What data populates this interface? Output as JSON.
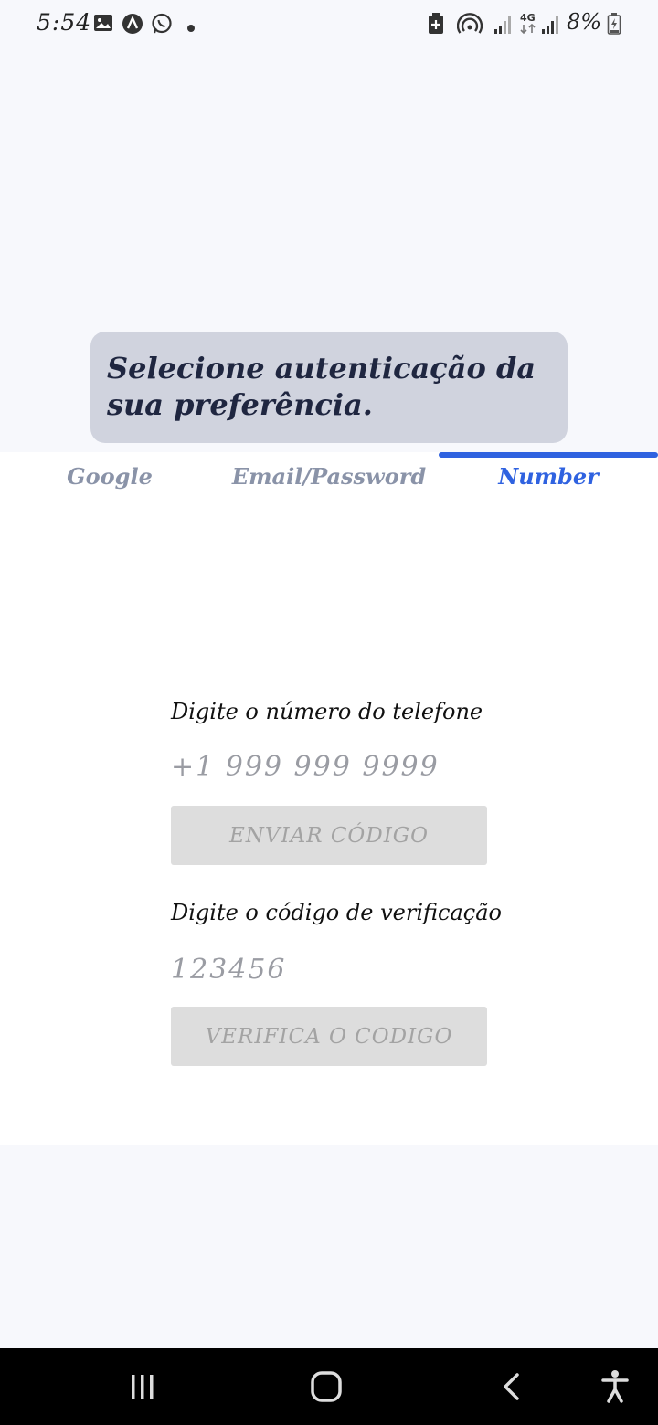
{
  "status_bar": {
    "time": "5:54",
    "battery_percent": "8%",
    "network": "4G",
    "icons": [
      "gallery-icon",
      "arrow-app-icon",
      "whatsapp-icon",
      "dot-icon",
      "battery-saver-icon",
      "hotspot-icon",
      "signal-icon",
      "signal-4g-icon",
      "battery-icon"
    ]
  },
  "info_card": {
    "text": "Selecione autenticação da sua preferência."
  },
  "tabs": {
    "items": [
      {
        "label": "Google",
        "active": false
      },
      {
        "label": "Email/Password",
        "active": false
      },
      {
        "label": "Number",
        "active": true
      }
    ]
  },
  "phone_form": {
    "phone_label": "Digite o número do telefone",
    "phone_placeholder": "+1 999 999 9999",
    "send_button": "ENVIAR CÓDIGO",
    "code_label": "Digite o código de verificação",
    "code_placeholder": "123456",
    "verify_button": "VERIFICA O CODIGO"
  },
  "nav_bar": {
    "icons": [
      "recent-apps-icon",
      "home-icon",
      "back-icon",
      "accessibility-icon"
    ]
  },
  "colors": {
    "accent": "#2f62e0",
    "card_bg": "#d0d3de",
    "button_disabled_bg": "#dddddd",
    "tab_inactive": "#8a93a8"
  }
}
